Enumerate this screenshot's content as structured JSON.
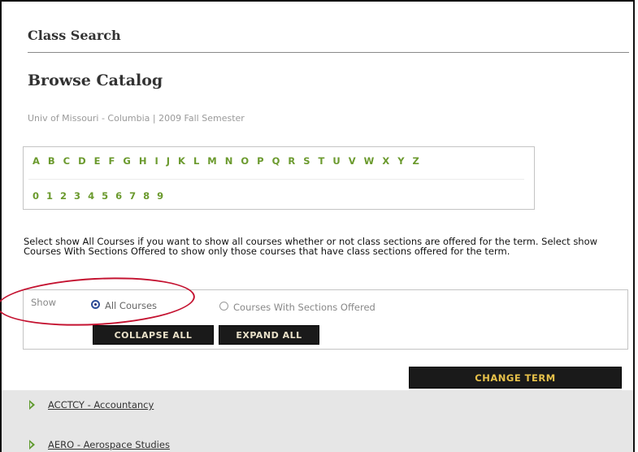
{
  "header": {
    "section_title": "Class Search",
    "page_title": "Browse Catalog",
    "term_line": "Univ of Missouri - Columbia | 2009 Fall Semester"
  },
  "catalog_index": {
    "letters": [
      "A",
      "B",
      "C",
      "D",
      "E",
      "F",
      "G",
      "H",
      "I",
      "J",
      "K",
      "L",
      "M",
      "N",
      "O",
      "P",
      "Q",
      "R",
      "S",
      "T",
      "U",
      "V",
      "W",
      "X",
      "Y",
      "Z"
    ],
    "digits": [
      "0",
      "1",
      "2",
      "3",
      "4",
      "5",
      "6",
      "7",
      "8",
      "9"
    ]
  },
  "instructions": "Select show All Courses if you want to show all courses whether or not class sections are offered for the term. Select show Courses With Sections Offered to show only those courses that have class sections offered for the term.",
  "show_options": {
    "label": "Show",
    "option_all": "All Courses",
    "option_sections": "Courses With Sections Offered",
    "selected": "All Courses"
  },
  "buttons": {
    "collapse_all": "COLLAPSE ALL",
    "expand_all": "EXPAND ALL",
    "change_term": "CHANGE TERM"
  },
  "subjects": [
    {
      "label": "ACCTCY - Accountancy"
    },
    {
      "label": "AERO - Aerospace Studies"
    }
  ],
  "colors": {
    "link_green": "#6b9a2e",
    "button_bg": "#1a1a1a",
    "button_text": "#e8c24a",
    "annotation_red": "#c41230"
  }
}
